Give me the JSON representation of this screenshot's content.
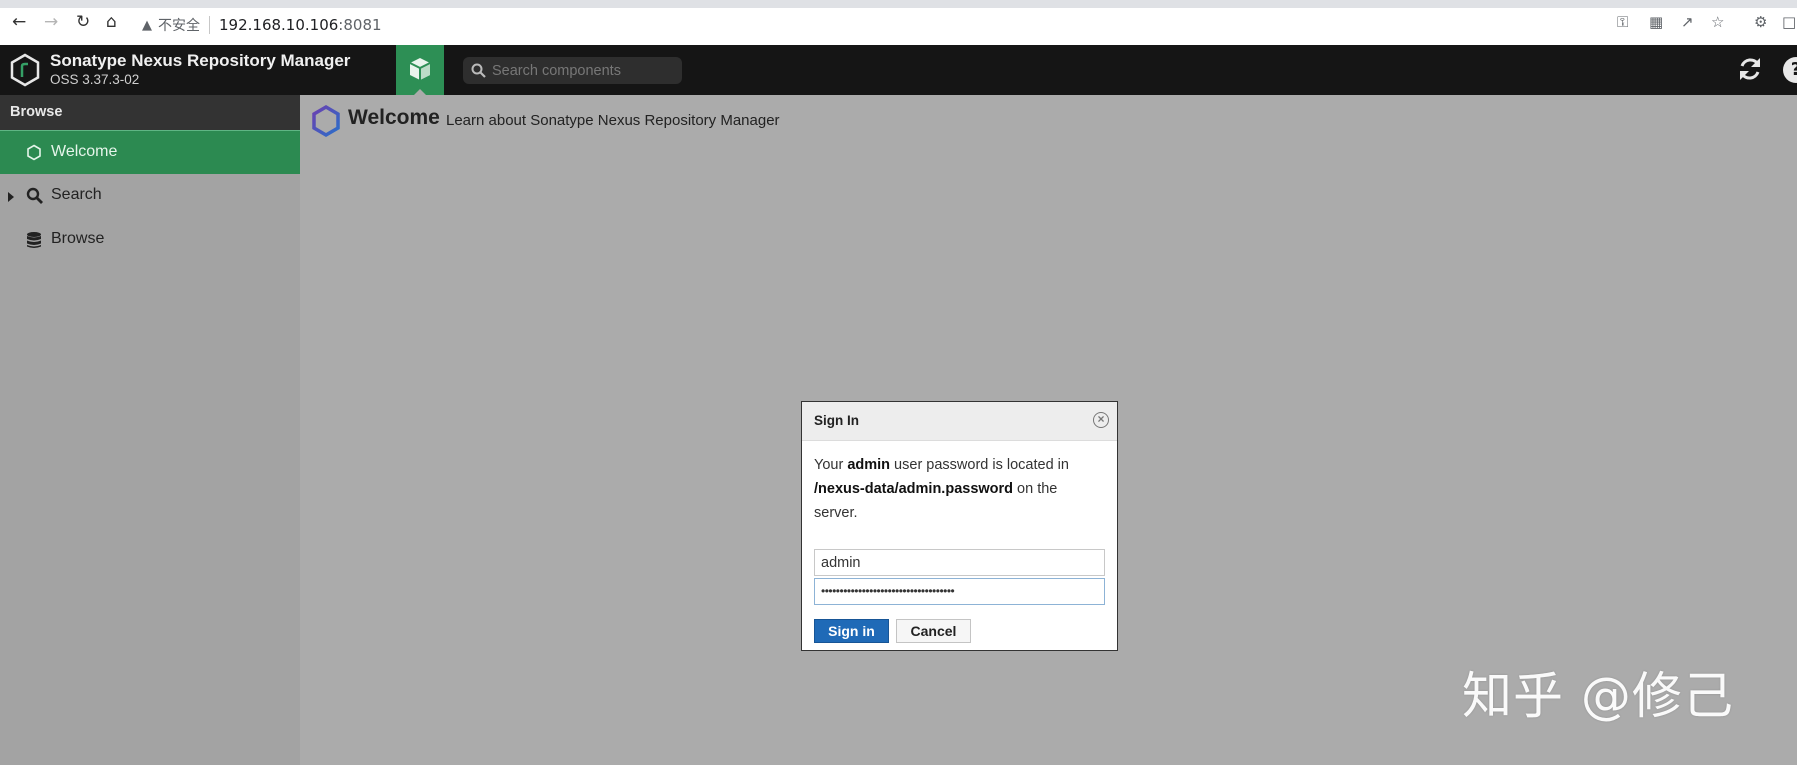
{
  "browser": {
    "security_label": "不安全",
    "url_host": "192.168.10.106",
    "url_port": ":8081"
  },
  "app": {
    "title": "Sonatype Nexus Repository Manager",
    "version": "OSS 3.37.3-02",
    "search_placeholder": "Search components",
    "accent_color": "#2c8a51"
  },
  "sidebar": {
    "header": "Browse",
    "items": [
      {
        "label": "Welcome",
        "icon": "hexagon-icon",
        "active": true
      },
      {
        "label": "Search",
        "icon": "search-icon",
        "active": false
      },
      {
        "label": "Browse",
        "icon": "database-icon",
        "active": false
      }
    ]
  },
  "main": {
    "title": "Welcome",
    "subtitle": "Learn about Sonatype Nexus Repository Manager"
  },
  "dialog": {
    "title": "Sign In",
    "message_pre": "Your ",
    "message_user": "admin",
    "message_mid": " user password is located in ",
    "message_path": "/nexus-data/admin.password",
    "message_post": " on the server.",
    "username_value": "admin",
    "password_masked": "••••••••••••••••••••••••••••••••••••",
    "signin_label": "Sign in",
    "cancel_label": "Cancel"
  },
  "watermark": "知乎 @修己"
}
